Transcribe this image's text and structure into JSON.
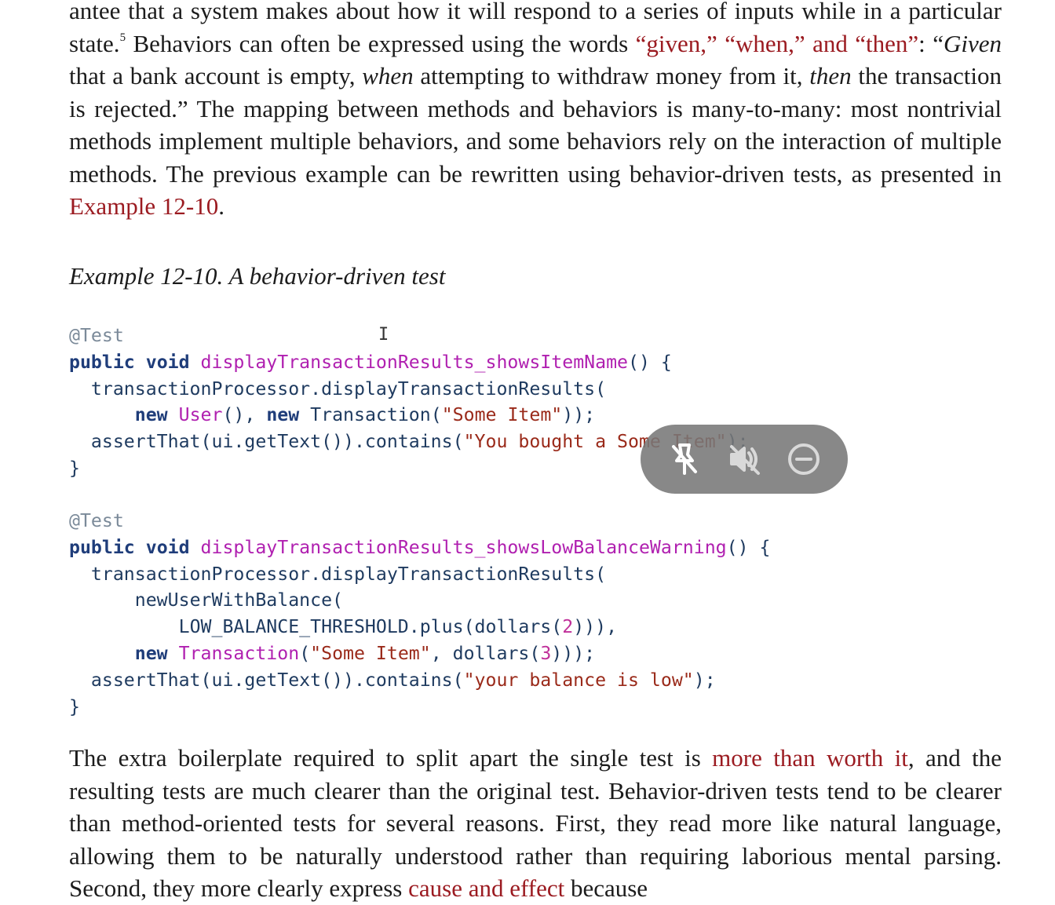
{
  "prose_top": {
    "t1": "antee that a system makes about how it will respond to a series of inputs while in a particular state.",
    "fn_mark": "5",
    "t2": " Behaviors can often be expressed using the words ",
    "link1": "“given,” “when,” and “then”",
    "t3": ": “",
    "given": "Given",
    "t4": " that a bank account is empty, ",
    "when": "when",
    "t5": " attempting to withdraw money from it, ",
    "then": "then",
    "t6": " the transaction is rejected.” The mapping between methods and behaviors is many-to-many: most nontrivial methods implement multiple behaviors, and some behaviors rely on the interaction of multiple methods. The previous example can be rewritten using behavior-driven tests, as presented in ",
    "link2": "Example 12-10",
    "t7": "."
  },
  "caption": "Example 12-10. A behavior-driven test",
  "code1": {
    "annotation": "@Test",
    "kw_public": "public",
    "kw_void": "void",
    "method": "displayTransactionResults_showsItemName",
    "l1_end": "() {",
    "l2_indent": "  ",
    "l2": "transactionProcessor.displayTransactionResults(",
    "l3_indent": "      ",
    "kw_new": "new",
    "cls_user": "User",
    "l3_mid": "(), ",
    "kw_new2": "new",
    "cls_tx": "Transaction",
    "l3_paren": "(",
    "str_item": "\"Some Item\"",
    "l3_end": "));",
    "l4_indent": "  ",
    "l4_a": "assertThat(ui.getText()).contains(",
    "str_bought": "\"You bought a Some Item\"",
    "l4_end": ");",
    "close": "}"
  },
  "code2": {
    "annotation": "@Test",
    "kw_public": "public",
    "kw_void": "void",
    "method": "displayTransactionResults_showsLowBalanceWarning",
    "l1_end": "() {",
    "l2_indent": "  ",
    "l2": "transactionProcessor.displayTransactionResults(",
    "l3_indent": "      ",
    "l3": "newUserWithBalance(",
    "l4_indent": "          ",
    "l4_a": "LOW_BALANCE_THRESHOLD.plus(dollars(",
    "num2": "2",
    "l4_end": "))),",
    "l5_indent": "      ",
    "kw_new": "new",
    "cls_tx": "Transaction",
    "l5_paren": "(",
    "str_item": "\"Some Item\"",
    "l5_mid": ", dollars(",
    "num3": "3",
    "l5_end": ")));",
    "l6_indent": "  ",
    "l6_a": "assertThat(ui.getText()).contains(",
    "str_low": "\"your balance is low\"",
    "l6_end": ");",
    "close": "}"
  },
  "prose_bottom": {
    "t1": "The extra boilerplate required to split apart the single test is ",
    "link1": "more than worth it",
    "t2": ", and the resulting tests are much clearer than the original test. Behavior-driven tests tend to be clearer than method-oriented tests for several reasons. First, they read more like natural language, allowing them to be naturally understood rather than requiring laborious mental parsing. Second, they more clearly express ",
    "link2": "cause and effect",
    "t3": " because"
  },
  "cursor_glyph": "I",
  "overlay": {
    "icons": [
      "unpin-icon",
      "mute-icon",
      "minimize-icon"
    ]
  }
}
